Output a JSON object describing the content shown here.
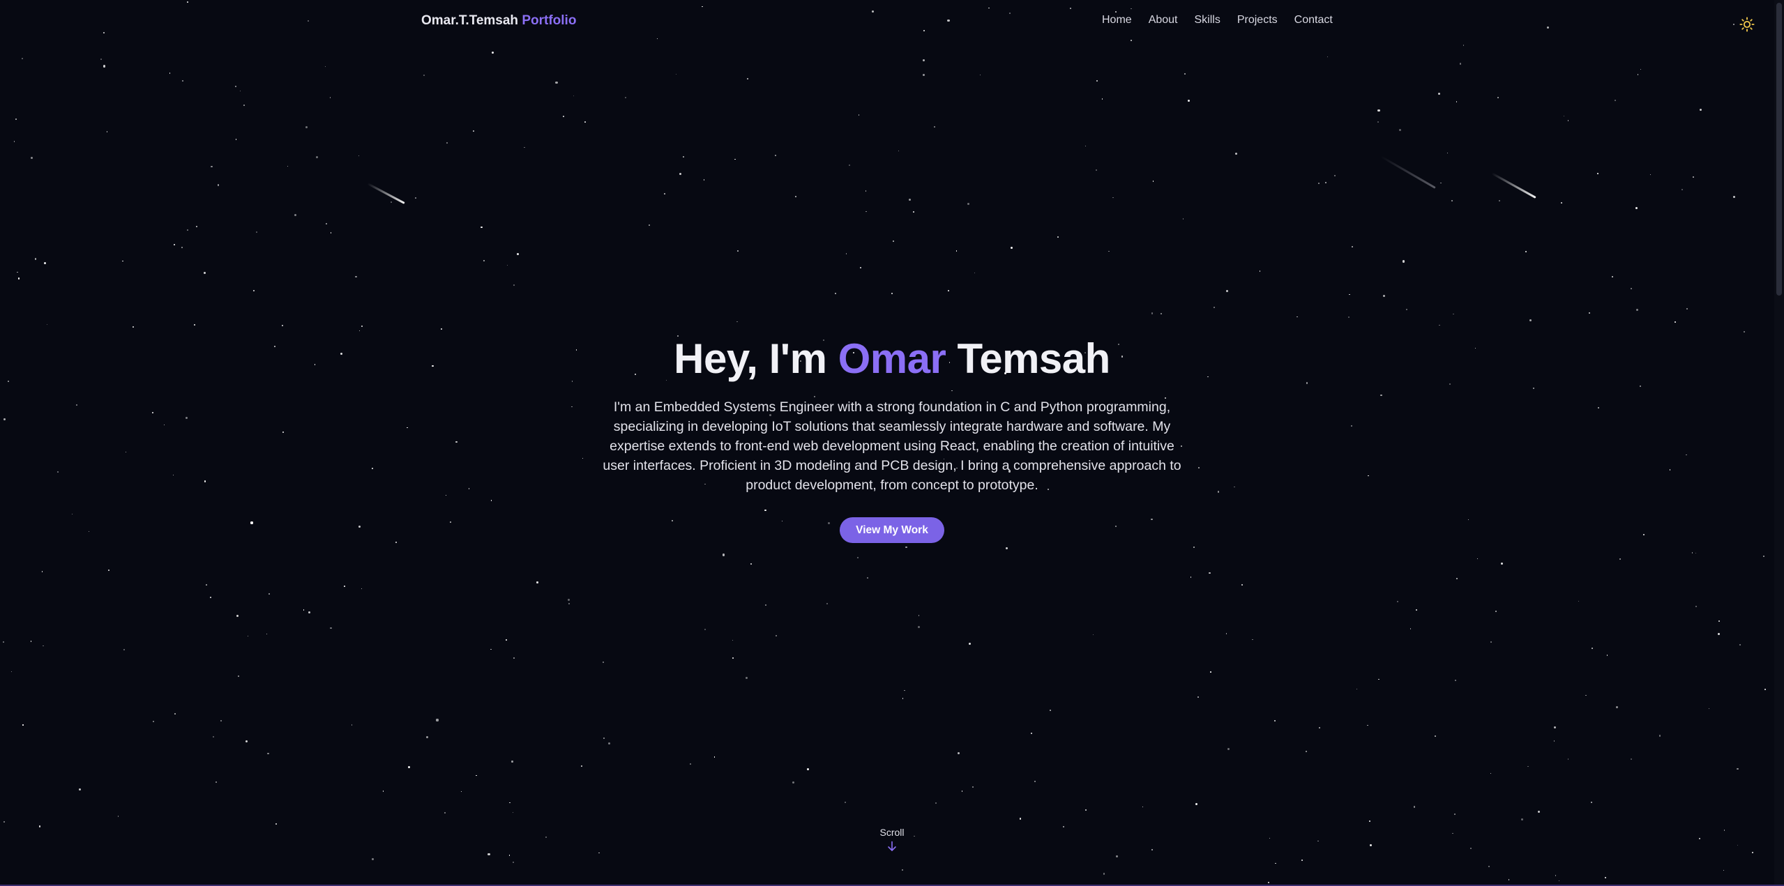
{
  "colors": {
    "background": "#070912",
    "accent": "#8b6ff5",
    "button": "#7b63e6",
    "text": "#f1f1f6",
    "theme_icon": "#f2c94c"
  },
  "navbar": {
    "brand_name": "Omar.T.Temsah",
    "brand_suffix": "Portfolio",
    "links": [
      {
        "label": "Home"
      },
      {
        "label": "About"
      },
      {
        "label": "Skills"
      },
      {
        "label": "Projects"
      },
      {
        "label": "Contact"
      }
    ],
    "theme_toggle_icon": "sun-icon"
  },
  "hero": {
    "greeting": "Hey, I'm ",
    "first_name": "Omar",
    "last_name": "Temsah",
    "bio": "I'm an Embedded Systems Engineer with a strong foundation in C and Python programming, specializing in developing IoT solutions that seamlessly integrate hardware and software. My expertise extends to front-end web development using React, enabling the creation of intuitive user interfaces. Proficient in 3D modeling and PCB design, I bring a comprehensive approach to product development, from concept to prototype.",
    "cta_label": "View My Work"
  },
  "scroll": {
    "label": "Scroll",
    "icon": "arrow-down-icon"
  }
}
